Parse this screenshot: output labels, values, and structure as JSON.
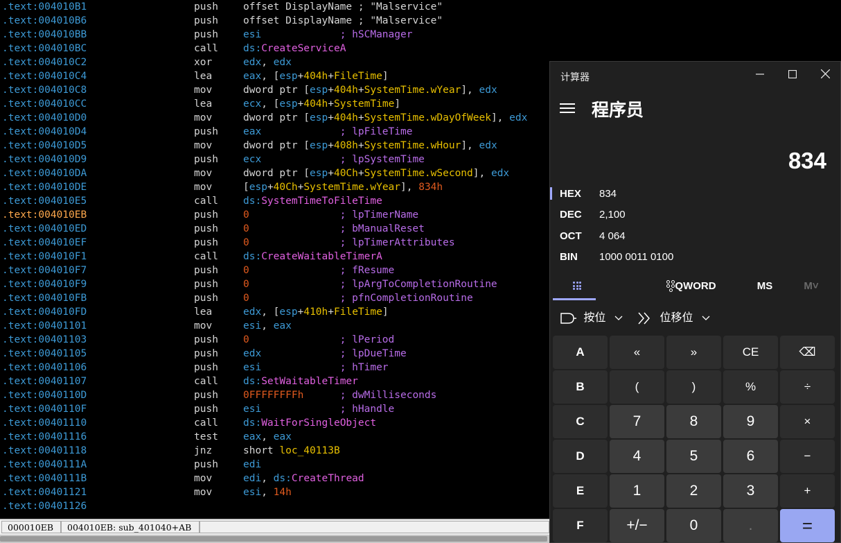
{
  "disassembly": [
    {
      "addr": ".text:004010B1",
      "mnemonic": "push",
      "ops": [
        [
          "t",
          "offset "
        ],
        [
          "t",
          "DisplayName"
        ],
        [
          "t",
          " ; \"Malservice\""
        ]
      ]
    },
    {
      "addr": ".text:004010B6",
      "mnemonic": "push",
      "ops": [
        [
          "t",
          "offset "
        ],
        [
          "t",
          "DisplayName"
        ],
        [
          "t",
          " ; \"Malservice\""
        ]
      ]
    },
    {
      "addr": ".text:004010BB",
      "mnemonic": "push",
      "ops": [
        [
          "r",
          "esi"
        ],
        [
          "c",
          "             ; hSCManager"
        ]
      ]
    },
    {
      "addr": ".text:004010BC",
      "mnemonic": "call",
      "ops": [
        [
          "r",
          "ds:"
        ],
        [
          "f",
          "CreateServiceA"
        ]
      ]
    },
    {
      "addr": ".text:004010C2",
      "mnemonic": "xor",
      "ops": [
        [
          "r",
          "edx"
        ],
        [
          "t",
          ", "
        ],
        [
          "r",
          "edx"
        ]
      ]
    },
    {
      "addr": ".text:004010C4",
      "mnemonic": "lea",
      "ops": [
        [
          "r",
          "eax"
        ],
        [
          "t",
          ", ["
        ],
        [
          "r",
          "esp"
        ],
        [
          "t",
          "+"
        ],
        [
          "l",
          "404h"
        ],
        [
          "t",
          "+"
        ],
        [
          "l",
          "FileTime"
        ],
        [
          "t",
          "]"
        ]
      ]
    },
    {
      "addr": ".text:004010C8",
      "mnemonic": "mov",
      "ops": [
        [
          "t",
          "dword ptr ["
        ],
        [
          "r",
          "esp"
        ],
        [
          "t",
          "+"
        ],
        [
          "l",
          "404h"
        ],
        [
          "t",
          "+"
        ],
        [
          "l",
          "SystemTime.wYear"
        ],
        [
          "t",
          "], "
        ],
        [
          "r",
          "edx"
        ]
      ]
    },
    {
      "addr": ".text:004010CC",
      "mnemonic": "lea",
      "ops": [
        [
          "r",
          "ecx"
        ],
        [
          "t",
          ", ["
        ],
        [
          "r",
          "esp"
        ],
        [
          "t",
          "+"
        ],
        [
          "l",
          "404h"
        ],
        [
          "t",
          "+"
        ],
        [
          "l",
          "SystemTime"
        ],
        [
          "t",
          "]"
        ]
      ]
    },
    {
      "addr": ".text:004010D0",
      "mnemonic": "mov",
      "ops": [
        [
          "t",
          "dword ptr ["
        ],
        [
          "r",
          "esp"
        ],
        [
          "t",
          "+"
        ],
        [
          "l",
          "404h"
        ],
        [
          "t",
          "+"
        ],
        [
          "l",
          "SystemTime.wDayOfWeek"
        ],
        [
          "t",
          "], "
        ],
        [
          "r",
          "edx"
        ]
      ]
    },
    {
      "addr": ".text:004010D4",
      "mnemonic": "push",
      "ops": [
        [
          "r",
          "eax"
        ],
        [
          "c",
          "             ; lpFileTime"
        ]
      ]
    },
    {
      "addr": ".text:004010D5",
      "mnemonic": "mov",
      "ops": [
        [
          "t",
          "dword ptr ["
        ],
        [
          "r",
          "esp"
        ],
        [
          "t",
          "+"
        ],
        [
          "l",
          "408h"
        ],
        [
          "t",
          "+"
        ],
        [
          "l",
          "SystemTime.wHour"
        ],
        [
          "t",
          "], "
        ],
        [
          "r",
          "edx"
        ]
      ]
    },
    {
      "addr": ".text:004010D9",
      "mnemonic": "push",
      "ops": [
        [
          "r",
          "ecx"
        ],
        [
          "c",
          "             ; lpSystemTime"
        ]
      ]
    },
    {
      "addr": ".text:004010DA",
      "mnemonic": "mov",
      "ops": [
        [
          "t",
          "dword ptr ["
        ],
        [
          "r",
          "esp"
        ],
        [
          "t",
          "+"
        ],
        [
          "l",
          "40Ch"
        ],
        [
          "t",
          "+"
        ],
        [
          "l",
          "SystemTime.wSecond"
        ],
        [
          "t",
          "], "
        ],
        [
          "r",
          "edx"
        ]
      ]
    },
    {
      "addr": ".text:004010DE",
      "mnemonic": "mov",
      "ops": [
        [
          "t",
          "["
        ],
        [
          "r",
          "esp"
        ],
        [
          "t",
          "+"
        ],
        [
          "l",
          "40Ch"
        ],
        [
          "t",
          "+"
        ],
        [
          "l",
          "SystemTime.wYear"
        ],
        [
          "t",
          "], "
        ],
        [
          "n",
          "834h"
        ]
      ]
    },
    {
      "addr": ".text:004010E5",
      "mnemonic": "call",
      "ops": [
        [
          "r",
          "ds:"
        ],
        [
          "f",
          "SystemTimeToFileTime"
        ]
      ]
    },
    {
      "addr": ".text:004010EB",
      "mnemonic": "push",
      "highlight": true,
      "ops": [
        [
          "n",
          "0"
        ],
        [
          "c",
          "               ; lpTimerName"
        ]
      ]
    },
    {
      "addr": ".text:004010ED",
      "mnemonic": "push",
      "ops": [
        [
          "n",
          "0"
        ],
        [
          "c",
          "               ; bManualReset"
        ]
      ]
    },
    {
      "addr": ".text:004010EF",
      "mnemonic": "push",
      "ops": [
        [
          "n",
          "0"
        ],
        [
          "c",
          "               ; lpTimerAttributes"
        ]
      ]
    },
    {
      "addr": ".text:004010F1",
      "mnemonic": "call",
      "ops": [
        [
          "r",
          "ds:"
        ],
        [
          "f",
          "CreateWaitableTimerA"
        ]
      ]
    },
    {
      "addr": ".text:004010F7",
      "mnemonic": "push",
      "ops": [
        [
          "n",
          "0"
        ],
        [
          "c",
          "               ; fResume"
        ]
      ]
    },
    {
      "addr": ".text:004010F9",
      "mnemonic": "push",
      "ops": [
        [
          "n",
          "0"
        ],
        [
          "c",
          "               ; lpArgToCompletionRoutine"
        ]
      ]
    },
    {
      "addr": ".text:004010FB",
      "mnemonic": "push",
      "ops": [
        [
          "n",
          "0"
        ],
        [
          "c",
          "               ; pfnCompletionRoutine"
        ]
      ]
    },
    {
      "addr": ".text:004010FD",
      "mnemonic": "lea",
      "ops": [
        [
          "r",
          "edx"
        ],
        [
          "t",
          ", ["
        ],
        [
          "r",
          "esp"
        ],
        [
          "t",
          "+"
        ],
        [
          "l",
          "410h"
        ],
        [
          "t",
          "+"
        ],
        [
          "l",
          "FileTime"
        ],
        [
          "t",
          "]"
        ]
      ]
    },
    {
      "addr": ".text:00401101",
      "mnemonic": "mov",
      "ops": [
        [
          "r",
          "esi"
        ],
        [
          "t",
          ", "
        ],
        [
          "r",
          "eax"
        ]
      ]
    },
    {
      "addr": ".text:00401103",
      "mnemonic": "push",
      "ops": [
        [
          "n",
          "0"
        ],
        [
          "c",
          "               ; lPeriod"
        ]
      ]
    },
    {
      "addr": ".text:00401105",
      "mnemonic": "push",
      "ops": [
        [
          "r",
          "edx"
        ],
        [
          "c",
          "             ; lpDueTime"
        ]
      ]
    },
    {
      "addr": ".text:00401106",
      "mnemonic": "push",
      "ops": [
        [
          "r",
          "esi"
        ],
        [
          "c",
          "             ; hTimer"
        ]
      ]
    },
    {
      "addr": ".text:00401107",
      "mnemonic": "call",
      "ops": [
        [
          "r",
          "ds:"
        ],
        [
          "f",
          "SetWaitableTimer"
        ]
      ]
    },
    {
      "addr": ".text:0040110D",
      "mnemonic": "push",
      "ops": [
        [
          "n",
          "0FFFFFFFFh"
        ],
        [
          "c",
          "      ; dwMilliseconds"
        ]
      ]
    },
    {
      "addr": ".text:0040110F",
      "mnemonic": "push",
      "ops": [
        [
          "r",
          "esi"
        ],
        [
          "c",
          "             ; hHandle"
        ]
      ]
    },
    {
      "addr": ".text:00401110",
      "mnemonic": "call",
      "ops": [
        [
          "r",
          "ds:"
        ],
        [
          "f",
          "WaitForSingleObject"
        ]
      ]
    },
    {
      "addr": ".text:00401116",
      "mnemonic": "test",
      "ops": [
        [
          "r",
          "eax"
        ],
        [
          "t",
          ", "
        ],
        [
          "r",
          "eax"
        ]
      ]
    },
    {
      "addr": ".text:00401118",
      "mnemonic": "jnz",
      "ops": [
        [
          "t",
          "short "
        ],
        [
          "l",
          "loc_40113B"
        ]
      ]
    },
    {
      "addr": ".text:0040111A",
      "mnemonic": "push",
      "ops": [
        [
          "r",
          "edi"
        ]
      ]
    },
    {
      "addr": ".text:0040111B",
      "mnemonic": "mov",
      "ops": [
        [
          "r",
          "edi"
        ],
        [
          "t",
          ", "
        ],
        [
          "r",
          "ds:"
        ],
        [
          "f",
          "CreateThread"
        ]
      ]
    },
    {
      "addr": ".text:00401121",
      "mnemonic": "mov",
      "ops": [
        [
          "r",
          "esi"
        ],
        [
          "t",
          ", "
        ],
        [
          "n",
          "14h"
        ]
      ]
    },
    {
      "addr": ".text:00401126",
      "mnemonic": "",
      "ops": []
    }
  ],
  "statusbar": {
    "offset": "000010EB",
    "location": "004010EB: sub_401040+AB",
    "extra": ""
  },
  "colors": {
    "register": "#3d9ad6",
    "function": "#e060e0",
    "number": "#e05a1e",
    "comment": "#b86ce8",
    "label": "#e8c000",
    "accent": "#9fa8ff"
  },
  "calculator": {
    "window_title": "计算器",
    "mode_title": "程序员",
    "display": "834",
    "bases": [
      {
        "label": "HEX",
        "value": "834",
        "active": true
      },
      {
        "label": "DEC",
        "value": "2,100"
      },
      {
        "label": "OCT",
        "value": "4 064"
      },
      {
        "label": "BIN",
        "value": "1000 0011 0100"
      }
    ],
    "tabs": {
      "word_size": "QWORD",
      "ms": "MS",
      "m": "M˅"
    },
    "bitwise_label": "按位",
    "bitshift_label": "位移位",
    "keys": [
      [
        "A",
        "«",
        "»",
        "CE",
        "⌫"
      ],
      [
        "B",
        "(",
        ")",
        "%",
        "÷"
      ],
      [
        "C",
        "7",
        "8",
        "9",
        "×"
      ],
      [
        "D",
        "4",
        "5",
        "6",
        "−"
      ],
      [
        "E",
        "1",
        "2",
        "3",
        "+"
      ],
      [
        "F",
        "+/−",
        "0",
        ".",
        "="
      ]
    ]
  }
}
